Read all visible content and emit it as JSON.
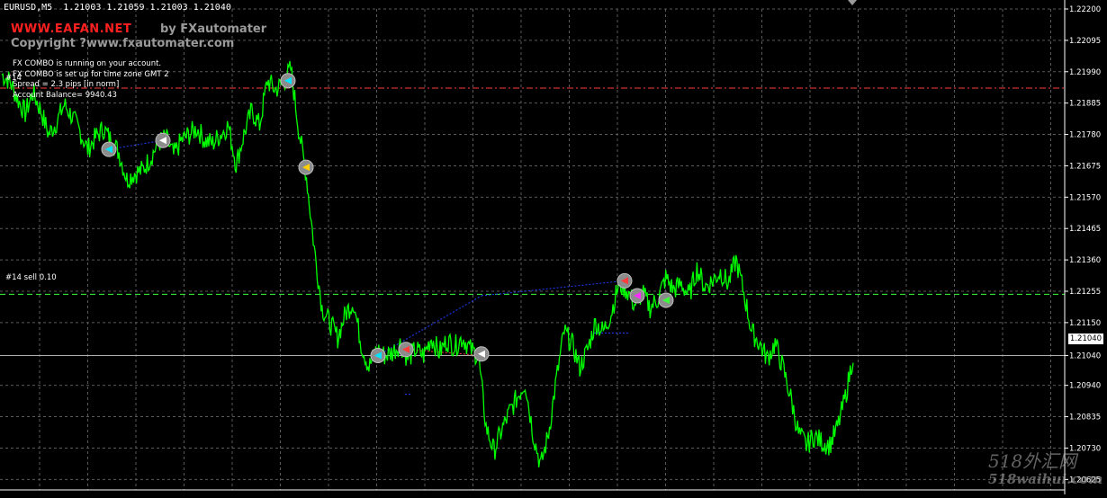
{
  "header": {
    "symbol_line": "EURUSD,M5  1.21003 1.21059 1.21003 1.21040"
  },
  "branding": {
    "site": "WWW.EAFAN.NET",
    "by": "by FXautomater",
    "copyright": "Copyright ?www.fxautomater.com"
  },
  "info_lines": [
    "FX COMBO is running on your account.",
    "FX COMBO is set up for time zone GMT 2",
    "Spread = 2.3 pips [in norm]",
    "Account Balance= 9940.43"
  ],
  "order_labels": {
    "top": "#14",
    "mid": "#14 sell 0.10"
  },
  "watermark": {
    "line1": "518外汇网",
    "line2": "518waihui.com"
  },
  "colors": {
    "background": "#000000",
    "price_line": "#00ff00",
    "grid": "#5a5a5a",
    "order_red": "#ff3b3b",
    "order_green": "#3cff3c",
    "trade_blue": "#1e3cff",
    "site_red": "#ff2020",
    "marker_gray": "#8c8c8c"
  },
  "chart_data": {
    "type": "line",
    "series": [
      {
        "values": [
          1.2198,
          1.2196,
          1.219,
          1.2185,
          1.2192,
          1.2186,
          1.2178,
          1.2182,
          1.2188,
          1.2184,
          1.2179,
          1.2173,
          1.2177,
          1.218,
          1.2176,
          1.2172,
          1.2163,
          1.2165,
          1.2166,
          1.217,
          1.2175,
          1.2177,
          1.2171,
          1.2176,
          1.2178,
          1.218,
          1.2176,
          1.2175,
          1.2178,
          1.2181,
          1.2168,
          1.2178,
          1.2186,
          1.2181,
          1.2196,
          1.2193,
          1.2195,
          1.22,
          1.218,
          1.2164,
          1.214,
          1.212,
          1.2115,
          1.211,
          1.2118,
          1.2122,
          1.2108,
          1.21,
          1.2106,
          1.2104,
          1.2105,
          1.2108,
          1.2103,
          1.2106,
          1.2104,
          1.211,
          1.2105,
          1.2109,
          1.2107,
          1.211,
          1.2106,
          1.2104,
          1.208,
          1.2072,
          1.2079,
          1.2085,
          1.209,
          1.2095,
          1.2078,
          1.2067,
          1.2078,
          1.2096,
          1.2112,
          1.2108,
          1.21,
          1.2106,
          1.2115,
          1.2112,
          1.2118,
          1.2128,
          1.2126,
          1.2121,
          1.2125,
          1.212,
          1.2123,
          1.213,
          1.2126,
          1.2128,
          1.2124,
          1.2133,
          1.2127,
          1.2129,
          1.2132,
          1.2128,
          1.2136,
          1.2125,
          1.2112,
          1.2108,
          1.2103,
          1.2108,
          1.21,
          1.209,
          1.2078,
          1.2074,
          1.2077,
          1.2075,
          1.2074,
          1.208,
          1.209,
          1.2104
        ]
      }
    ],
    "ylim": [
      1.2062,
      1.222
    ],
    "yticks": [
      "1.22200",
      "1.22095",
      "1.21990",
      "1.21885",
      "1.21780",
      "1.21675",
      "1.21570",
      "1.21465",
      "1.21360",
      "1.21255",
      "1.21150",
      "1.21040",
      "1.20940",
      "1.20835",
      "1.20730",
      "1.20625"
    ],
    "current_price": "1.21040",
    "order_lines": [
      {
        "label": "#14",
        "value": 1.21935,
        "color": "red"
      },
      {
        "label": "#14 sell 0.10",
        "value": 1.21245,
        "color": "green"
      }
    ],
    "grid": true
  }
}
